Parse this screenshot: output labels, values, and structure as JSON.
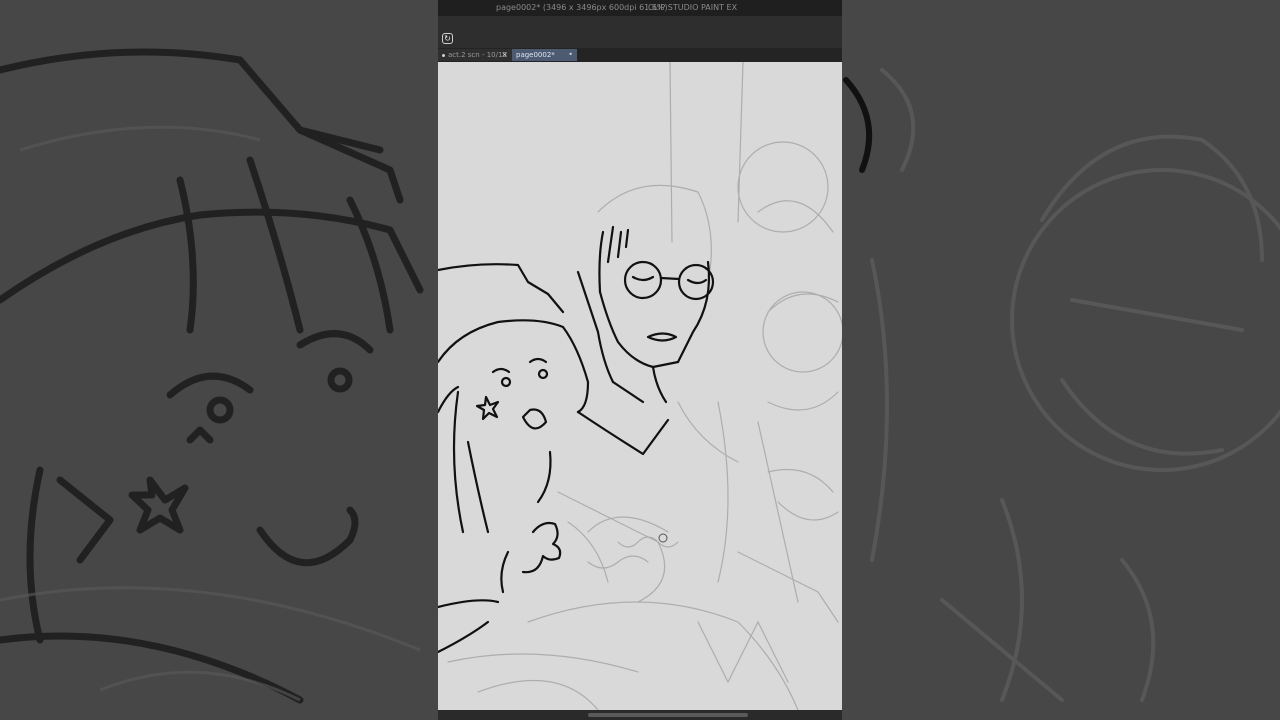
{
  "window": {
    "document_info": "page0002* (3496 x 3496px 600dpi 61.6%)",
    "app_name": "CLIP STUDIO PAINT EX"
  },
  "toolbar": {
    "icon": "layer-property-icon"
  },
  "tabs": [
    {
      "label": "act.2 scn - 10/13",
      "active": false
    },
    {
      "label": "page0002*",
      "active": true
    }
  ],
  "canvas": {
    "content": "manga page sketch and inks"
  },
  "colors": {
    "canvas_bg": "#d9d9d9",
    "active_tab": "#4c5a72",
    "titlebar": "#1f1f1f"
  }
}
